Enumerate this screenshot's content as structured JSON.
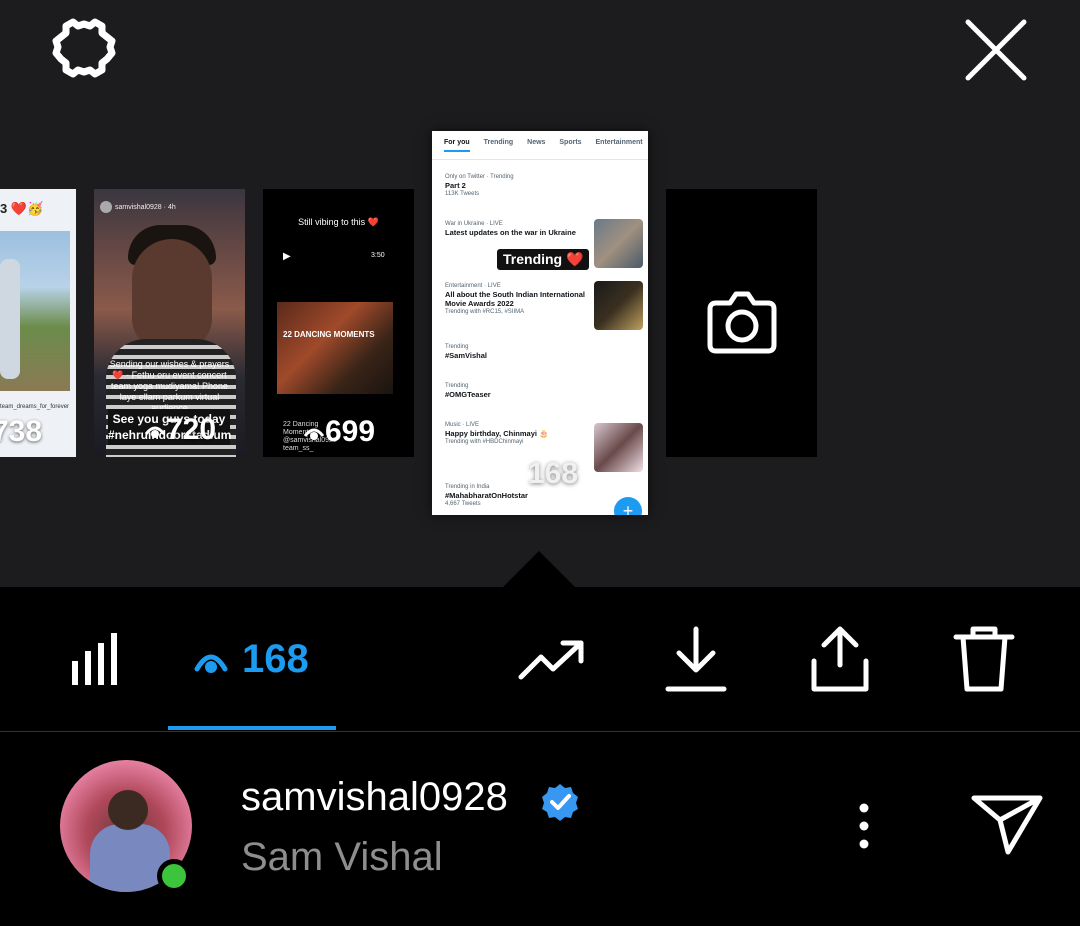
{
  "top_bar": {
    "settings_icon": "gear-icon",
    "close_icon": "close-icon"
  },
  "stories": [
    {
      "header": "3 ❤️🥳",
      "caption": "team_dreams_for_forever",
      "views": "738"
    },
    {
      "username": "samvishal0928",
      "time": "4h",
      "caption": "Sending our wishes & prayers ❤️ - Fethu oru event concert team yoga mudiyama! Phone laye ellam parkum virtual audience",
      "tag": "See you guys today #nehruindoorstadium",
      "views": "720"
    },
    {
      "title": "Still vibing to this ❤️",
      "duration": "3:50",
      "thumb_label": "22 DANCING MOMENTS",
      "meta": "22 Dancing Moments @samvishal0928 team_ss_",
      "views": "699"
    },
    {
      "tabs": [
        "For you",
        "Trending",
        "News",
        "Sports",
        "Entertainment"
      ],
      "trends": [
        {
          "meta": "Only on Twitter · Trending",
          "headline": "Part 2",
          "sub": "113K Tweets"
        },
        {
          "meta": "War in Ukraine · LIVE",
          "headline": "Latest updates on the war in Ukraine",
          "sub": ""
        },
        {
          "meta": "Entertainment · LIVE",
          "headline": "All about the South Indian International Movie Awards 2022",
          "sub": "Trending with #RC15, #SIIMA"
        },
        {
          "meta": "Trending",
          "headline": "#SamVishal",
          "sub": ""
        },
        {
          "meta": "Trending",
          "headline": "#OMGTeaser",
          "sub": ""
        },
        {
          "meta": "Music · LIVE",
          "headline": "Happy birthday, Chinmayi 🎂",
          "sub": "Trending with #HBDChinmayi"
        },
        {
          "meta": "Trending in India",
          "headline": "#MahabharatOnHotstar",
          "sub": "4,667 Tweets"
        }
      ],
      "sticker": "Trending ❤️",
      "views": "168",
      "selected": true
    },
    {
      "type": "add-story",
      "icon": "camera-icon"
    }
  ],
  "action_bar": {
    "insights_icon": "bar-chart-icon",
    "views_icon": "eye-icon",
    "views_count": "168",
    "boost_icon": "trending-up-icon",
    "download_icon": "download-icon",
    "share_icon": "share-icon",
    "delete_icon": "trash-icon",
    "accent": "#1d9bf0"
  },
  "profile": {
    "username": "samvishal0928",
    "verified": true,
    "full_name": "Sam Vishal",
    "online": true,
    "more_icon": "more-vertical-icon",
    "send_icon": "send-icon",
    "online_color": "#3cc43c"
  }
}
